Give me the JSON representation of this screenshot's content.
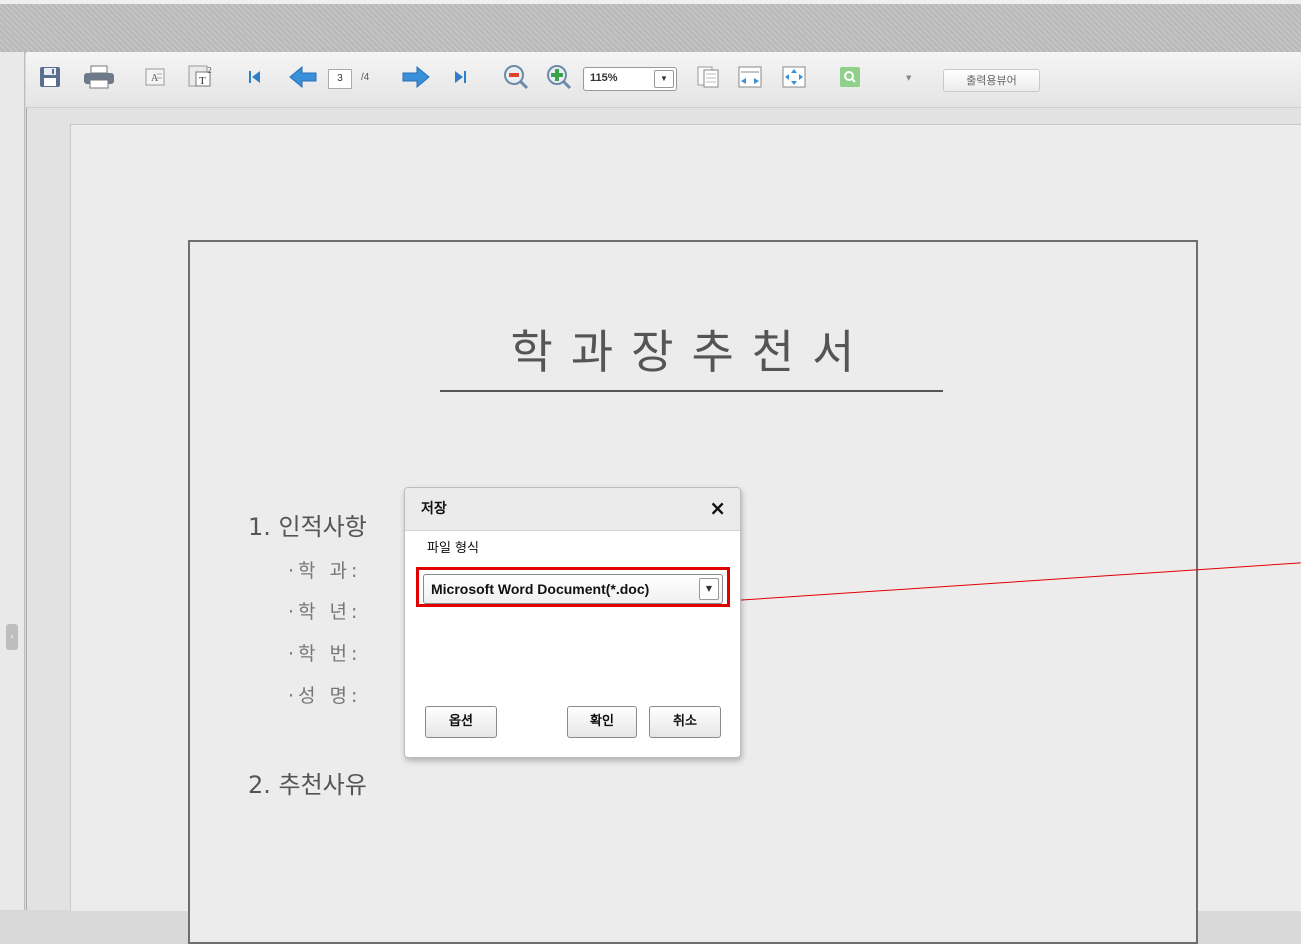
{
  "toolbar": {
    "page_current": "3",
    "page_total": "/4",
    "zoom": "115%",
    "zoom_arrow": "▼",
    "small_dropdown": "▼",
    "print_viewer_label": "출력용뷰어",
    "icons": [
      "save-icon",
      "print-icon",
      "text-export-icon",
      "font-settings-icon",
      "first-page-icon",
      "previous-page-icon",
      "next-page-icon",
      "last-page-icon",
      "zoom-out-icon",
      "zoom-in-icon",
      "single-page-icon",
      "fit-width-icon",
      "fit-page-icon",
      "search-icon"
    ]
  },
  "document": {
    "title": "학과장추천서",
    "section1": "1. 인적사항",
    "fields": [
      "·학  과:",
      "·학  년:",
      "·학  번:",
      "·성  명:"
    ],
    "section2": "2. 추천사유"
  },
  "dialog": {
    "title": "저장",
    "close": "×",
    "format_label": "파일 형식",
    "format_value": "Microsoft Word Document(*.doc)",
    "format_arrow": "▼",
    "options_button": "옵션",
    "confirm_button": "확인",
    "cancel_button": "취소"
  },
  "colors": {
    "highlight": "#e00000"
  }
}
